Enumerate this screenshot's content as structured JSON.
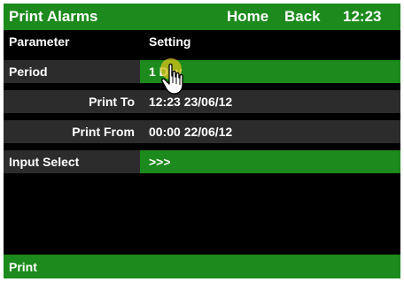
{
  "header": {
    "title": "Print Alarms",
    "home": "Home",
    "back": "Back",
    "time": "12:23"
  },
  "columns": {
    "parameter": "Parameter",
    "setting": "Setting"
  },
  "rows": {
    "period": {
      "label": "Period",
      "value": "1 Day"
    },
    "print_to": {
      "label": "Print To",
      "value": "12:23  23/06/12"
    },
    "print_from": {
      "label": "Print From",
      "value": "00:00  22/06/12"
    },
    "input_select": {
      "label": "Input Select",
      "value": ">>>"
    }
  },
  "footer": {
    "print": "Print"
  },
  "colors": {
    "accent_green": "#1c8a1c",
    "row_gray": "#2c2c2c",
    "background": "#000000",
    "text": "#ffffff",
    "touch_highlight": "#d4c21a"
  },
  "icons": {
    "cursor": "hand-pointer-icon"
  }
}
